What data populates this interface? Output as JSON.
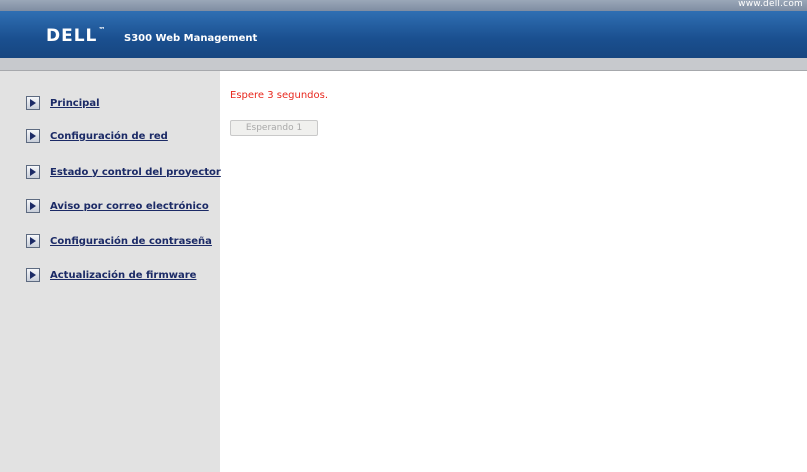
{
  "header": {
    "site_url": "www.dell.com",
    "logo_text": "DELL",
    "logo_tm": "™",
    "product_title": "S300 Web Management"
  },
  "sidebar": {
    "items": [
      {
        "label": "Principal",
        "icon": "play-arrow-icon"
      },
      {
        "label": "Configuración de red",
        "icon": "play-arrow-icon"
      },
      {
        "label": "Estado y control del proyector",
        "icon": "play-arrow-icon"
      },
      {
        "label": "Aviso por correo electrónico",
        "icon": "play-arrow-icon"
      },
      {
        "label": "Configuración de contraseña",
        "icon": "play-arrow-icon"
      },
      {
        "label": "Actualización de firmware",
        "icon": "play-arrow-icon"
      }
    ]
  },
  "main": {
    "message": "Espere 3 segundos.",
    "wait_button_label": "Esperando 1"
  },
  "colors": {
    "header_blue": "#1a4f8f",
    "message_red": "#e8281e",
    "link_navy": "#1b2a66",
    "sidebar_gray": "#e2e2e2"
  }
}
